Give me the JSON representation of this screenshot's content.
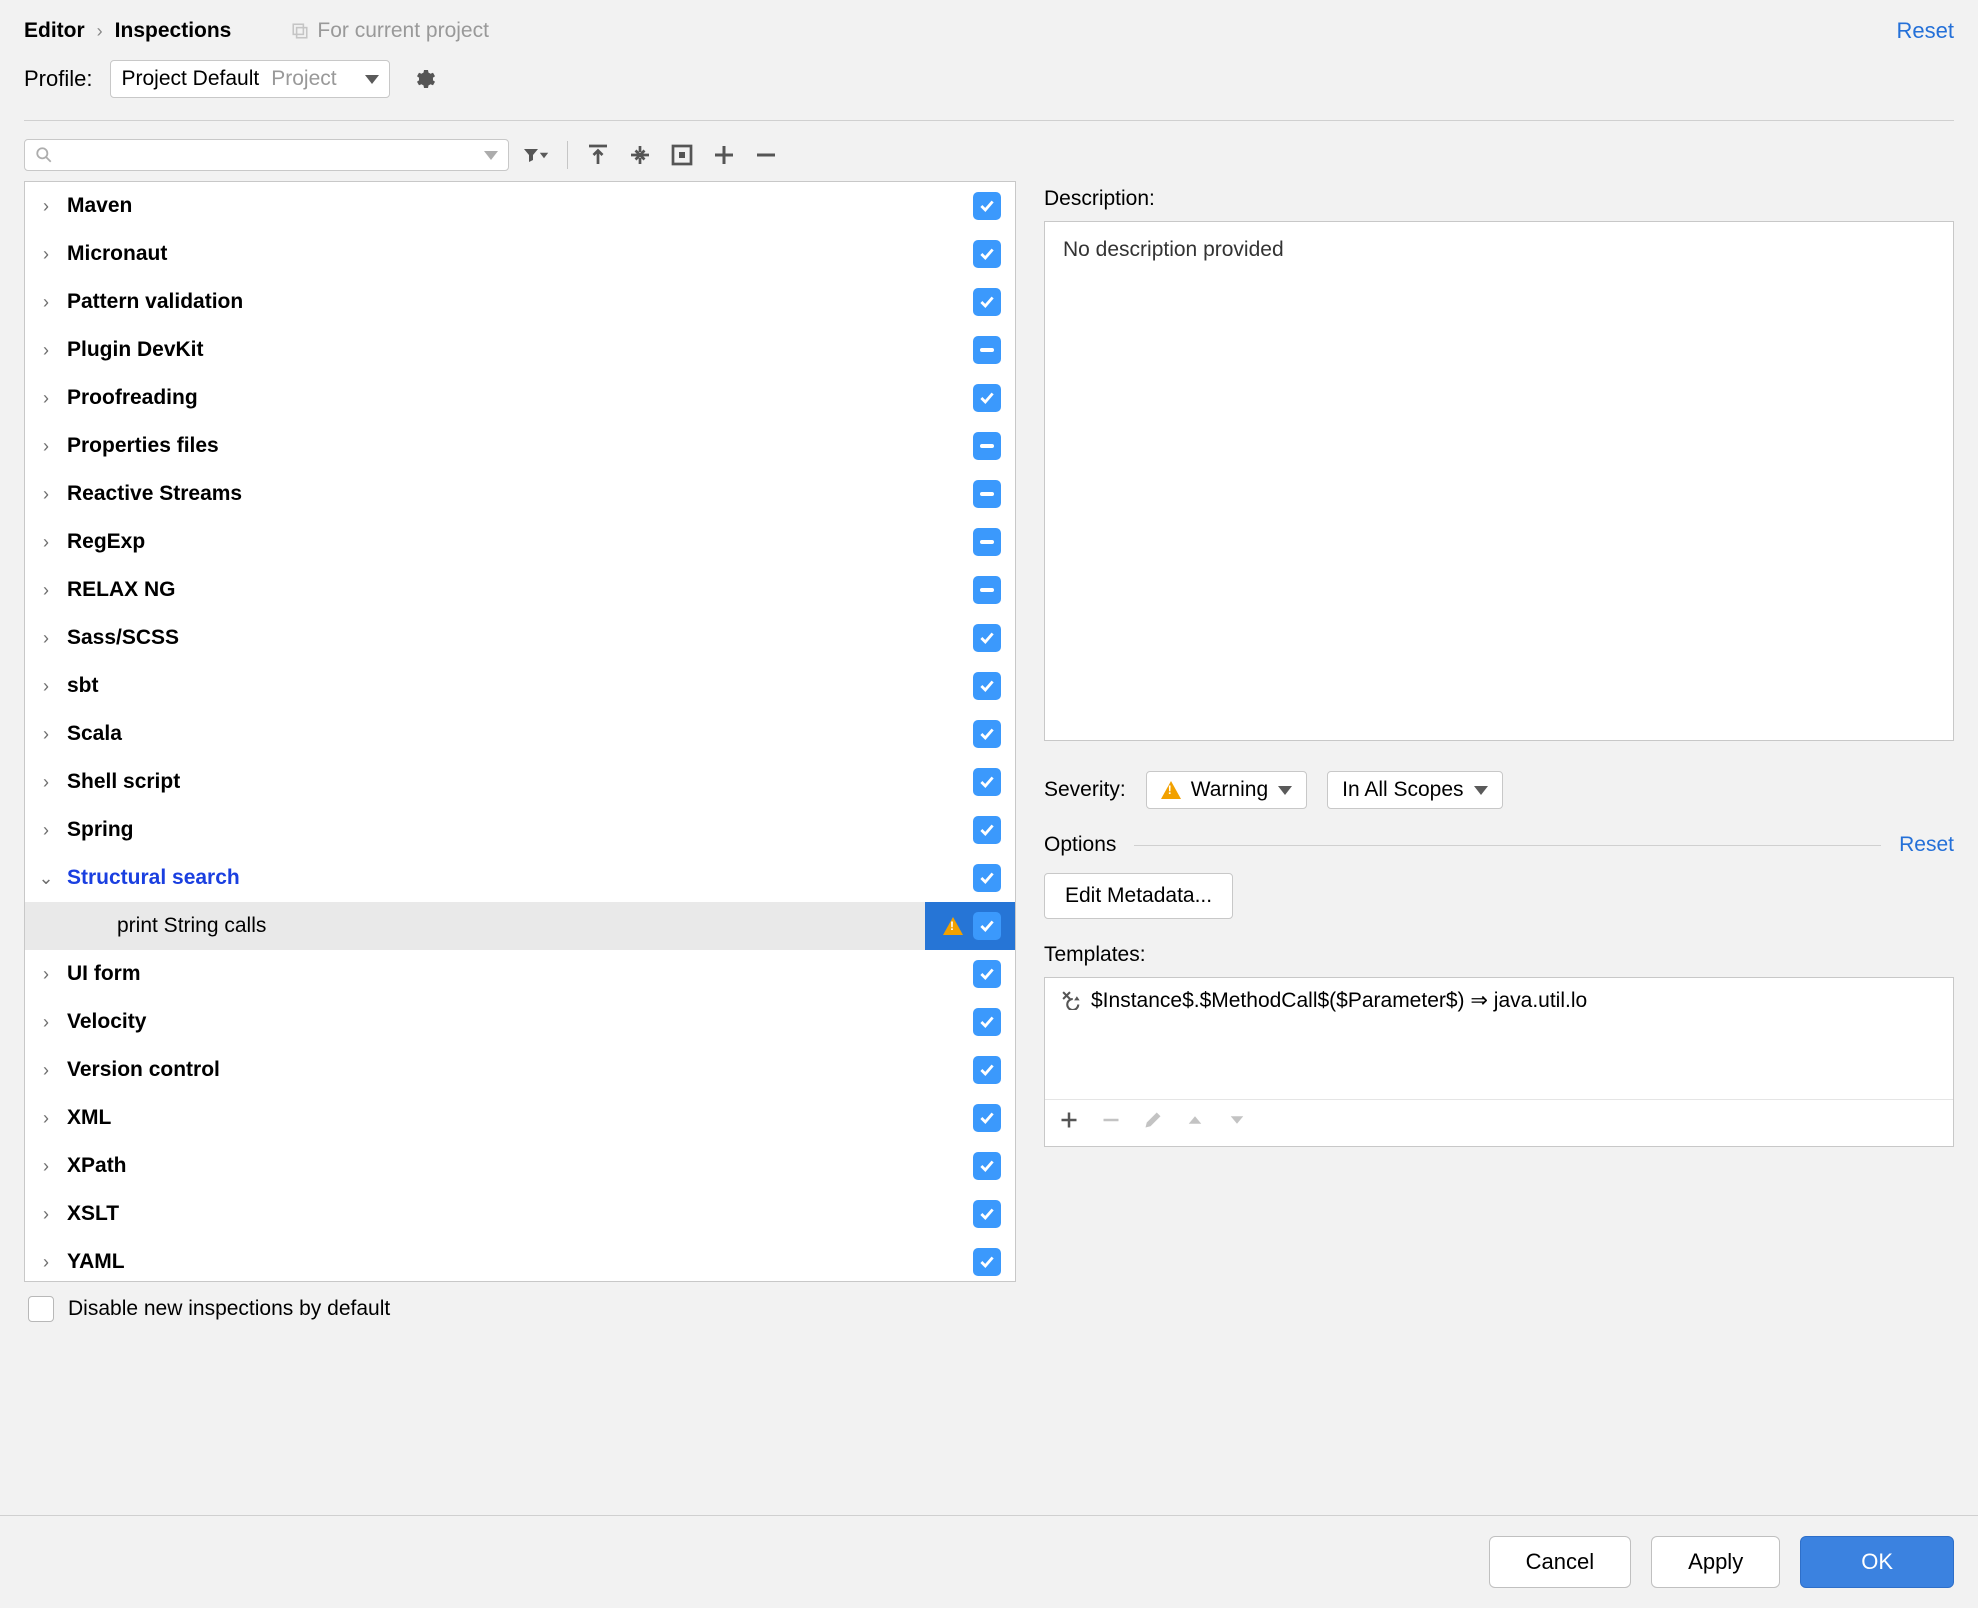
{
  "header": {
    "breadcrumb_parent": "Editor",
    "breadcrumb_current": "Inspections",
    "scope_text": "For current project",
    "reset": "Reset"
  },
  "profile": {
    "label": "Profile:",
    "name": "Project Default",
    "type": "Project"
  },
  "tree": [
    {
      "label": "Maven",
      "state": "checked",
      "expandable": true
    },
    {
      "label": "Micronaut",
      "state": "checked",
      "expandable": true
    },
    {
      "label": "Pattern validation",
      "state": "checked",
      "expandable": true
    },
    {
      "label": "Plugin DevKit",
      "state": "mixed",
      "expandable": true
    },
    {
      "label": "Proofreading",
      "state": "checked",
      "expandable": true
    },
    {
      "label": "Properties files",
      "state": "mixed",
      "expandable": true
    },
    {
      "label": "Reactive Streams",
      "state": "mixed",
      "expandable": true
    },
    {
      "label": "RegExp",
      "state": "mixed",
      "expandable": true
    },
    {
      "label": "RELAX NG",
      "state": "mixed",
      "expandable": true
    },
    {
      "label": "Sass/SCSS",
      "state": "checked",
      "expandable": true
    },
    {
      "label": "sbt",
      "state": "checked",
      "expandable": true
    },
    {
      "label": "Scala",
      "state": "checked",
      "expandable": true
    },
    {
      "label": "Shell script",
      "state": "checked",
      "expandable": true
    },
    {
      "label": "Spring",
      "state": "checked",
      "expandable": true
    },
    {
      "label": "Structural search",
      "state": "checked",
      "expandable": true,
      "expanded": true,
      "highlighted": true
    },
    {
      "label": "print String calls",
      "state": "checked",
      "child": true,
      "selected": true,
      "warn": true
    },
    {
      "label": "UI form",
      "state": "checked",
      "expandable": true
    },
    {
      "label": "Velocity",
      "state": "checked",
      "expandable": true
    },
    {
      "label": "Version control",
      "state": "checked",
      "expandable": true
    },
    {
      "label": "XML",
      "state": "checked",
      "expandable": true
    },
    {
      "label": "XPath",
      "state": "checked",
      "expandable": true
    },
    {
      "label": "XSLT",
      "state": "checked",
      "expandable": true
    },
    {
      "label": "YAML",
      "state": "checked",
      "expandable": true
    }
  ],
  "disable_new": "Disable new inspections by default",
  "detail": {
    "description_label": "Description:",
    "description_text": "No description provided",
    "severity_label": "Severity:",
    "severity_value": "Warning",
    "scope_value": "In All Scopes",
    "options_label": "Options",
    "options_reset": "Reset",
    "edit_metadata": "Edit Metadata...",
    "templates_label": "Templates:",
    "template_text": "$Instance$.$MethodCall$($Parameter$) ⇒ java.util.lo"
  },
  "footer": {
    "cancel": "Cancel",
    "apply": "Apply",
    "ok": "OK"
  }
}
